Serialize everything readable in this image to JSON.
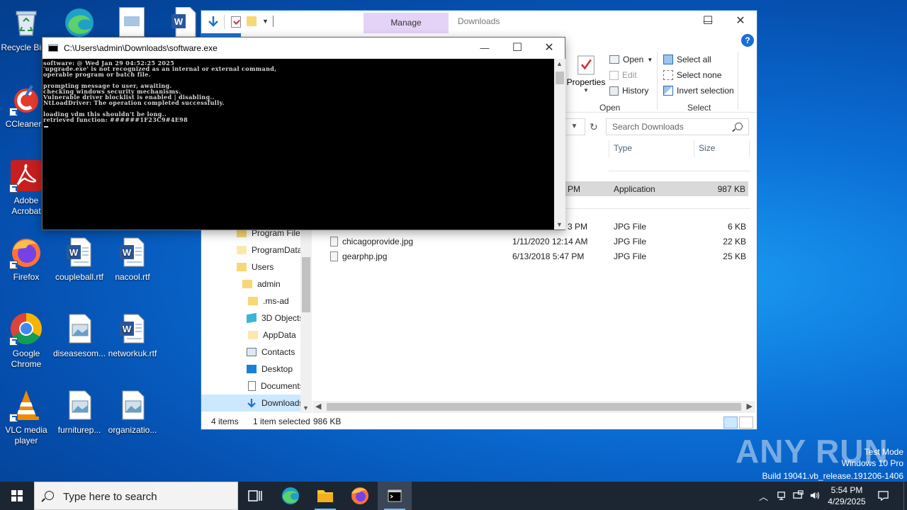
{
  "desktop": {
    "icons": [
      {
        "label": "Recycle Bin",
        "icon": "recycle-bin-icon"
      },
      {
        "label": "CCleaner",
        "icon": "ccleaner-icon"
      },
      {
        "label": "Adobe Acrobat",
        "icon": "acrobat-icon"
      },
      {
        "label": "Firefox",
        "icon": "firefox-icon"
      },
      {
        "label": "Google Chrome",
        "icon": "chrome-icon"
      },
      {
        "label": "VLC media player",
        "icon": "vlc-icon"
      },
      {
        "label": "coupleball.rtf",
        "icon": "word-doc-icon"
      },
      {
        "label": "diseasesom...",
        "icon": "image-file-icon"
      },
      {
        "label": "furniturep...",
        "icon": "image-file-icon"
      },
      {
        "label": "nacool.rtf",
        "icon": "word-doc-icon"
      },
      {
        "label": "networkuk.rtf",
        "icon": "word-doc-icon"
      },
      {
        "label": "organizatio...",
        "icon": "image-file-icon"
      }
    ],
    "watermark": {
      "line1": "Test Mode",
      "line2": "Windows 10 Pro",
      "line3": "Build 19041.vb_release.191206-1406"
    },
    "brand": "ANY RUN"
  },
  "explorer": {
    "manage_tab": "Manage",
    "title": "Downloads",
    "controls": {
      "minimize": "—",
      "maximize": "☐",
      "close": "✕",
      "help": "?"
    },
    "ribbon": {
      "properties": "Properties",
      "open": "Open",
      "edit": "Edit",
      "history": "History",
      "group_open": "Open",
      "select_all": "Select all",
      "select_none": "Select none",
      "invert_selection": "Invert selection",
      "group_select": "Select"
    },
    "search_placeholder": "Search Downloads",
    "columns": {
      "type": "Type",
      "size": "Size"
    },
    "nav": [
      {
        "label": "Program Files",
        "icon": "folder-icon"
      },
      {
        "label": "ProgramData",
        "icon": "folder-icon"
      },
      {
        "label": "Users",
        "icon": "folder-icon"
      },
      {
        "label": "admin",
        "icon": "folder-icon"
      },
      {
        "label": ".ms-ad",
        "icon": "folder-icon"
      },
      {
        "label": "3D Objects",
        "icon": "3d-objects-icon"
      },
      {
        "label": "AppData",
        "icon": "folder-icon"
      },
      {
        "label": "Contacts",
        "icon": "contacts-icon"
      },
      {
        "label": "Desktop",
        "icon": "desktop-icon"
      },
      {
        "label": "Documents",
        "icon": "documents-icon"
      },
      {
        "label": "Downloads",
        "icon": "downloads-icon"
      }
    ],
    "files": [
      {
        "name": "",
        "date": "PM",
        "type": "Application",
        "size": "987 KB"
      },
      {
        "name": "",
        "date": "3 PM",
        "type": "JPG File",
        "size": "6 KB"
      },
      {
        "name": "chicagoprovide.jpg",
        "date": "1/11/2020 12:14 AM",
        "type": "JPG File",
        "size": "22 KB"
      },
      {
        "name": "gearphp.jpg",
        "date": "6/13/2018 5:47 PM",
        "type": "JPG File",
        "size": "25 KB"
      }
    ],
    "status": {
      "items": "4 items",
      "selected": "1 item selected",
      "size": "986 KB"
    }
  },
  "console": {
    "title": "C:\\Users\\admin\\Downloads\\software.exe",
    "lines": [
      "software: @ Wed Jan 29 04:52:25 2025",
      "'upgrade.exe' is not recognized as an internal or external command,",
      "operable program or batch file.",
      "",
      "prompting message to user, awaiting.",
      "checking windows security mechanisms.",
      "Vulnerable driver blocklist is enabled | disabling..",
      "NtLoadDriver: The operation completed successfully.",
      "",
      "loading vdm this shouldn't be long..",
      "retrieved function: ######1F23C9#4E98"
    ]
  },
  "taskbar": {
    "search_placeholder": "Type here to search",
    "time": "5:54 PM",
    "date": "4/29/2025"
  }
}
